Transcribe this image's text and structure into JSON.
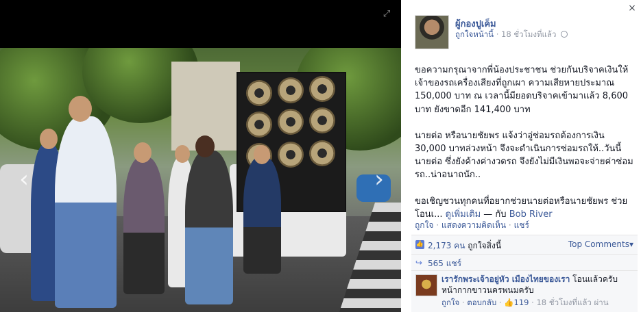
{
  "viewer": {
    "fullscreen_icon": "expand-icon",
    "prev_icon": "chevron-left-icon",
    "next_icon": "chevron-right-icon",
    "close_glyph": "×"
  },
  "post": {
    "author": "ผู้กองปูเค็ม",
    "like_page": "ถูกใจหน้านี้",
    "dot": "·",
    "time": "18 ชั่วโมงที่แล้ว",
    "privacy_icon": "globe-icon",
    "paragraph1": "ขอความกรุณาจากพี่น้องประชาชน ช่วยกันบริจาคเงินให้เจ้าของรถเครื่องเสียงที่ถูกเผา ความเสียหายประมาณ 150,000 บาท ณ เวลานี้มียอดบริจาคเข้ามาแล้ว 8,600 บาท ยังขาดอีก 141,400 บาท",
    "paragraph2": "นายต่อ หรือนายชัยพร แจ้งว่าอู่ซ่อมรถต้องการเงิน 30,000 บาทล่วงหน้า จึงจะดำเนินการซ่อมรถให้..วันนี้นายต่อ ซึ่งยังค้างค่างวดรถ จึงยังไม่มีเงินพอจะจ่ายค่าซ่อมรถ..น่าอนาถนัก..",
    "paragraph3": "ขอเชิญชวนทุกคนที่อยากช่วยนายต่อหรือนายชัยพร ช่วยโอนเ...",
    "see_more": "ดูเพิ่มเติม",
    "with_text": "— กับ",
    "tagged": "Bob River"
  },
  "actions": {
    "like": "ถูกใจ",
    "comment": "แสดงความคิดเห็น",
    "share": "แชร์",
    "sep": "·"
  },
  "ufi": {
    "likes_count": "2,173 คน",
    "likes_suffix": "ถูกใจสิ่งนี้",
    "top_comments": "Top Comments",
    "top_comments_caret": "▾",
    "shares": "565 แชร์"
  },
  "comment": {
    "author": "เรารักพระเจ้าอยู่หัว เมืองไทยของเรา",
    "text": "โอนแล้วครับ หน้ากากขาวนครพนมครับ",
    "like": "ถูกใจ",
    "reply": "ตอบกลับ",
    "like_count": "119",
    "time": "18 ชั่วโมงที่แล้ว ผ่าน"
  },
  "colors": {
    "link": "#3b5998",
    "meta": "#9197a3",
    "ufi_bg": "#f6f7f9"
  }
}
